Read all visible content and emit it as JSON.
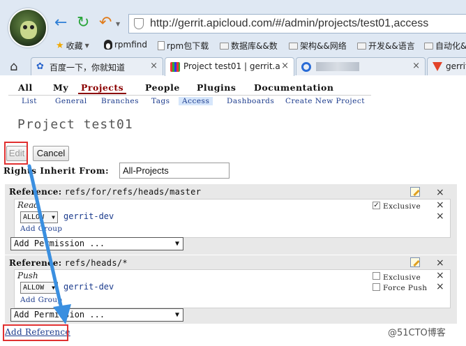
{
  "browser": {
    "url": "http://gerrit.apicloud.com/#/admin/projects/test01,access",
    "bookmarks": [
      {
        "label": "收藏",
        "icon": "star-icon"
      },
      {
        "label": "rpmfind",
        "icon": "penguin-icon"
      },
      {
        "label": "rpm包下载",
        "icon": "page-icon"
      },
      {
        "label": "数据库&&数",
        "icon": "folder-icon"
      },
      {
        "label": "架构&&网络",
        "icon": "folder-icon"
      },
      {
        "label": "开发&&语言",
        "icon": "folder-icon"
      },
      {
        "label": "自动化&",
        "icon": "folder-icon"
      }
    ],
    "tabs": [
      {
        "label": "百度一下，你就知道",
        "icon": "baidu-paw-icon"
      },
      {
        "label": "Project test01 | gerrit.a",
        "icon": "gerrit-icon"
      },
      {
        "label": "",
        "icon": "circle-icon"
      },
      {
        "label": "gerrit",
        "icon": "gitlab-icon"
      }
    ],
    "close_glyph": "×"
  },
  "gerrit": {
    "top_menu": [
      "All",
      "My",
      "Projects",
      "People",
      "Plugins",
      "Documentation"
    ],
    "sub_menu": [
      "List",
      "General",
      "Branches",
      "Tags",
      "Access",
      "Dashboards",
      "Create New Project"
    ],
    "page_title": "Project test01",
    "edit_button": "Edit",
    "cancel_button": "Cancel",
    "rights_inherit_label": "Rights Inherit From:",
    "rights_inherit_value": "All-Projects",
    "references": [
      {
        "label": "Reference:",
        "path": "refs/for/refs/heads/master",
        "permission": "Read",
        "rule_action": "ALLOW",
        "group": "gerrit-dev",
        "add_group": "Add Group",
        "checkboxes": [
          {
            "label": "Exclusive",
            "checked": true
          }
        ],
        "add_permission": "Add Permission ..."
      },
      {
        "label": "Reference:",
        "path": "refs/heads/*",
        "permission": "Push",
        "rule_action": "ALLOW",
        "group": "gerrit-dev",
        "add_group": "Add Group",
        "checkboxes": [
          {
            "label": "Exclusive",
            "checked": false
          },
          {
            "label": "Force Push",
            "checked": false
          }
        ],
        "add_permission": "Add Permission ..."
      }
    ],
    "add_reference": "Add Reference"
  },
  "watermark": "@51CTO博客",
  "colors": {
    "annotation_red": "#e03030",
    "annotation_arrow": "#3a8fe0",
    "link_blue": "#1a3a8c",
    "selected_menu": "#8b0000"
  }
}
